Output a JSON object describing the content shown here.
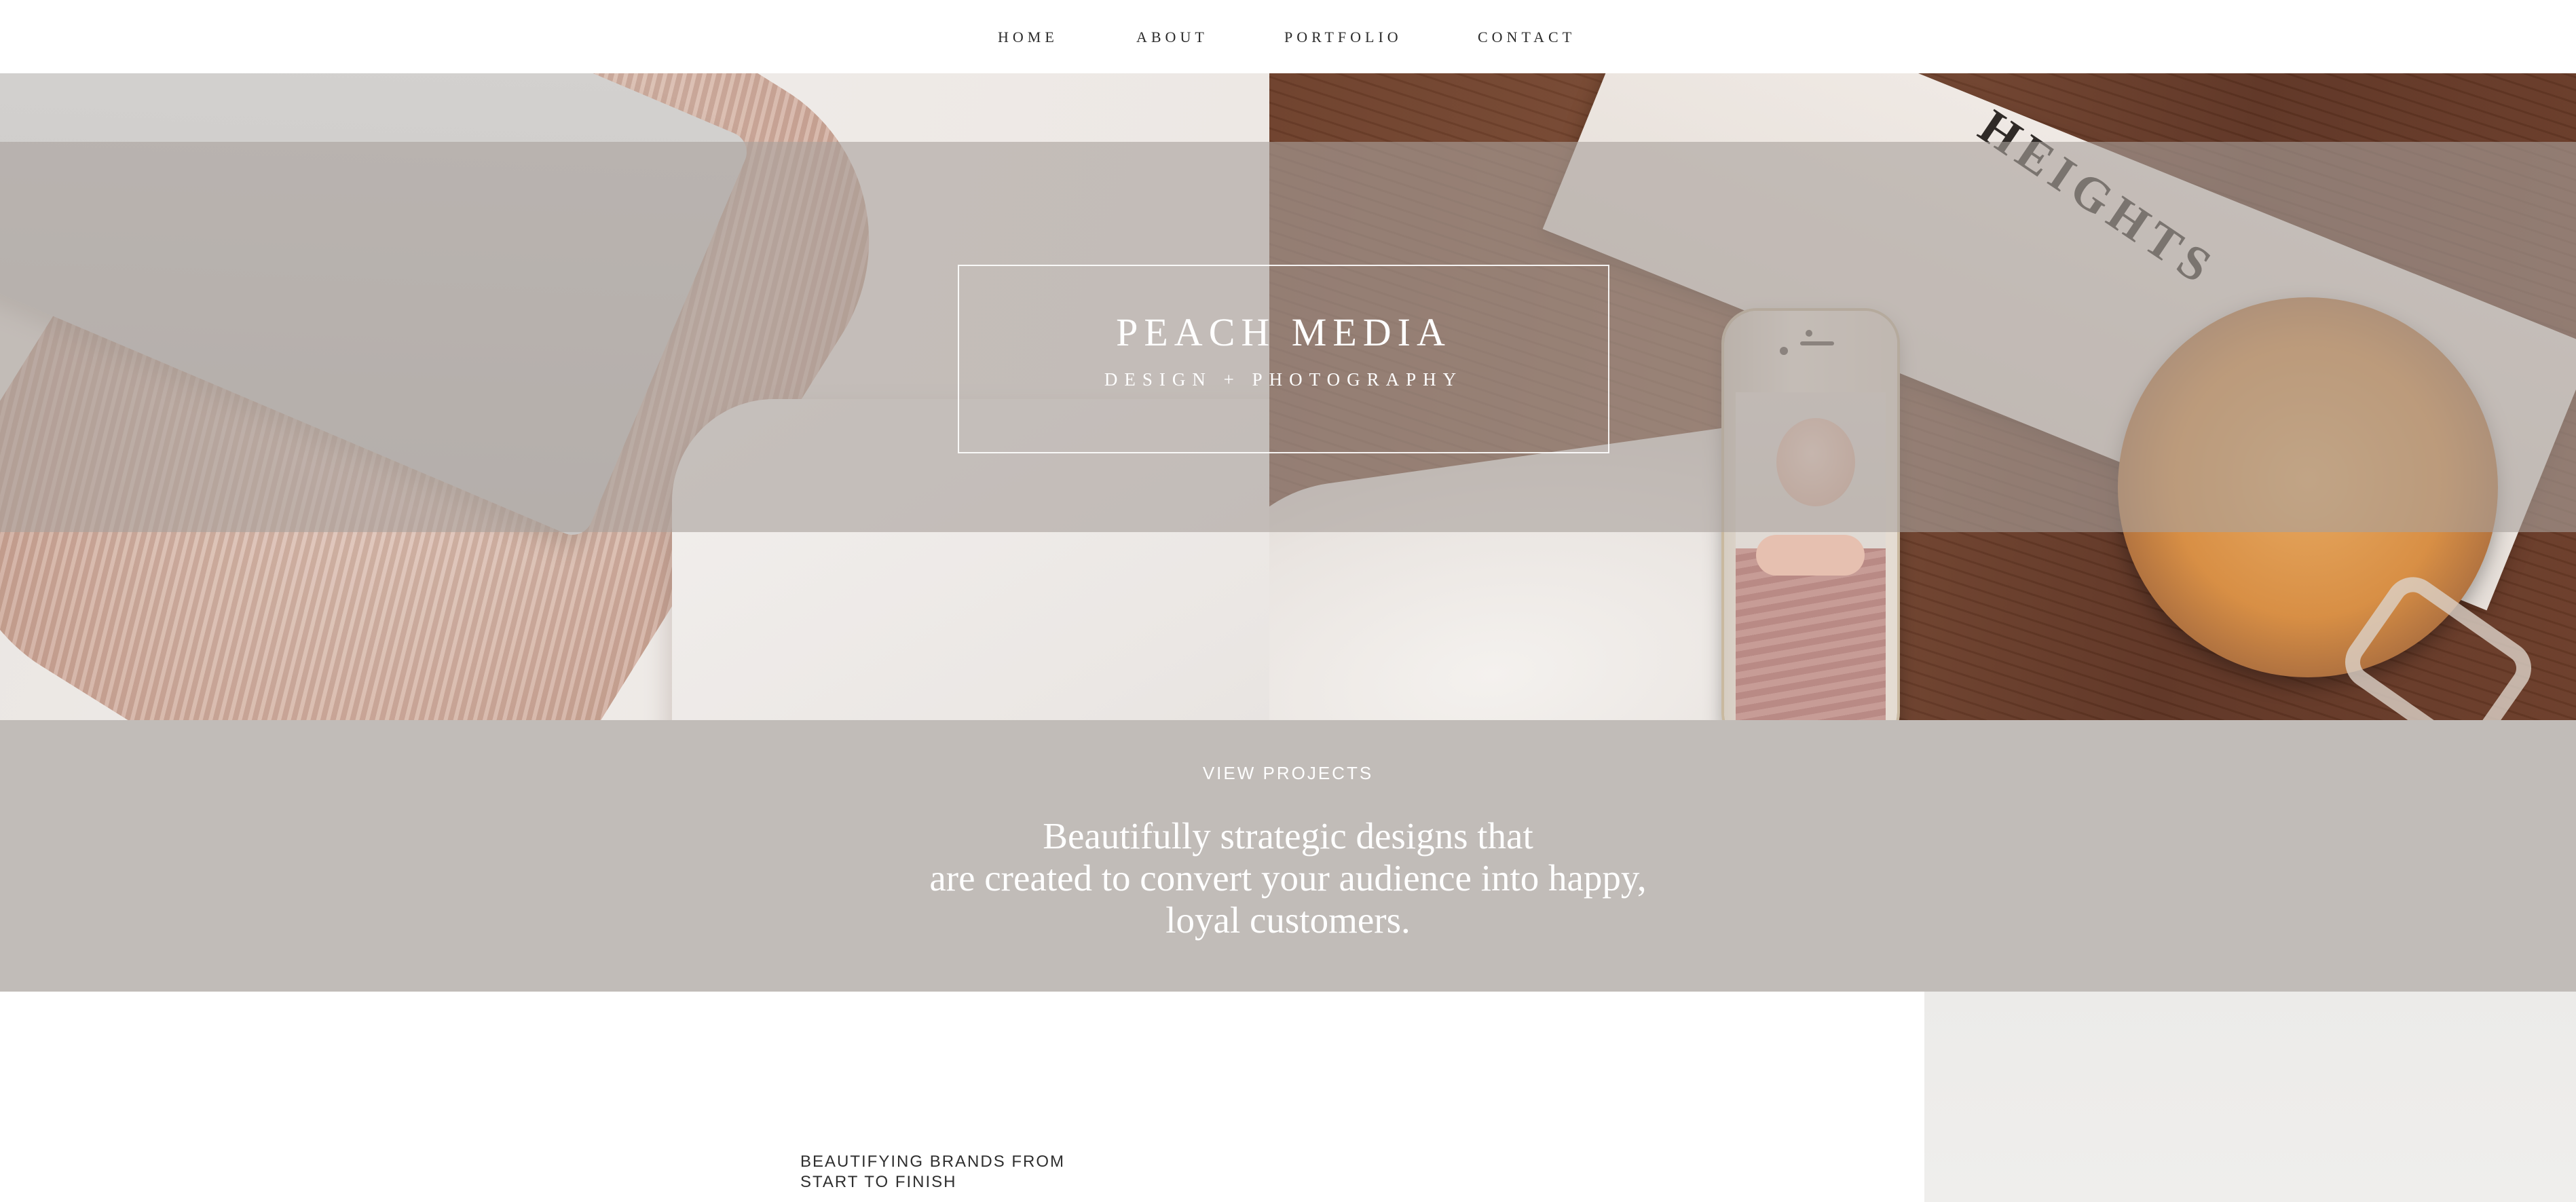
{
  "nav": {
    "items": [
      {
        "label": "HOME"
      },
      {
        "label": "ABOUT"
      },
      {
        "label": "PORTFOLIO"
      },
      {
        "label": "CONTACT"
      }
    ]
  },
  "hero": {
    "title": "PEACH MEDIA",
    "subtitle": "DESIGN + PHOTOGRAPHY",
    "book_text": "HEIGHTS"
  },
  "tagline": {
    "cta": "VIEW PROJECTS",
    "lines": [
      "Beautifully strategic designs that",
      "are created to convert your audience into happy,",
      "loyal customers."
    ]
  },
  "intro": {
    "heading_lines": [
      "BEAUTIFYING BRANDS FROM",
      "START TO FINISH"
    ]
  },
  "colors": {
    "band_overlay": "#aaa29c",
    "tagline_bg": "#c1bcb8",
    "text_dark": "#2b2b2b",
    "white": "#ffffff"
  }
}
